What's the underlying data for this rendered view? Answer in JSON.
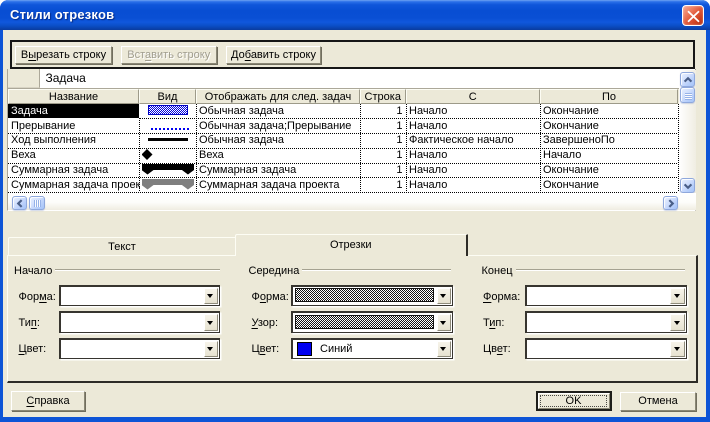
{
  "window": {
    "title": "Стили отрезков"
  },
  "toolbar": {
    "cut": {
      "pre": "В",
      "key": "ы",
      "post": "резать строку"
    },
    "insert": {
      "pre": "Вст",
      "key": "а",
      "post": "вить строку"
    },
    "add": {
      "pre": "До",
      "key": "б",
      "post": "авить строку"
    }
  },
  "entry_bar": {
    "value": "Задача"
  },
  "table": {
    "columns": [
      "Название",
      "Вид",
      "Отображать для след. задач",
      "Строка",
      "С",
      "По"
    ],
    "rows": [
      {
        "name": "Задача",
        "bar": "task-bar-blue-hatched",
        "show_for": "Обычная задача",
        "row": "1",
        "from": "Начало",
        "to": "Окончание",
        "selected": true
      },
      {
        "name": "Прерывание",
        "bar": "interruption-dotted-blue",
        "show_for": "Обычная задача;Прерывание",
        "row": "1",
        "from": "Начало",
        "to": "Окончание"
      },
      {
        "name": "Ход выполнения",
        "bar": "progress-solid-black",
        "show_for": "Обычная задача",
        "row": "1",
        "from": "Фактическое начало",
        "to": "ЗавершеноПо"
      },
      {
        "name": "Веха",
        "bar": "milestone-diamond",
        "show_for": "Веха",
        "row": "1",
        "from": "Начало",
        "to": "Начало"
      },
      {
        "name": "Суммарная задача",
        "bar": "summary-black",
        "show_for": "Суммарная задача",
        "row": "1",
        "from": "Начало",
        "to": "Окончание"
      },
      {
        "name": "Суммарная задача проекта",
        "bar": "project-summary-gray",
        "show_for": "Суммарная задача проекта",
        "row": "1",
        "from": "Начало",
        "to": "Окончание"
      }
    ]
  },
  "tabs": {
    "text": "Текст",
    "bars": "Отрезки"
  },
  "groups": {
    "start": {
      "label": "Начало",
      "shape": {
        "pre": "Фор",
        "key": "м",
        "post": "а:",
        "value": ""
      },
      "type": {
        "pre": "Ти",
        "key": "п",
        "post": ":",
        "value": ""
      },
      "color": {
        "pre": "",
        "key": "Ц",
        "post": "вет:",
        "value": ""
      }
    },
    "middle": {
      "label": "Середина",
      "shape": {
        "pre": "Ф",
        "key": "о",
        "post": "рма:",
        "value": "hatched-pattern-swatch"
      },
      "pattern": {
        "pre": "",
        "key": "У",
        "post": "зор:",
        "value": "hatched-pattern-swatch"
      },
      "color": {
        "pre": "Ц",
        "key": "в",
        "post": "ет:",
        "value": "Синий",
        "swatch": "#0000F0"
      }
    },
    "end": {
      "label": "Конец",
      "shape": {
        "pre": "",
        "key": "Ф",
        "post": "орма:",
        "value": ""
      },
      "type": {
        "pre": "Т",
        "key": "и",
        "post": "п:",
        "value": ""
      },
      "color": {
        "pre": "Цв",
        "key": "е",
        "post": "т:",
        "value": ""
      }
    }
  },
  "footer": {
    "help": {
      "pre": "",
      "key": "С",
      "post": "правка"
    },
    "ok": "OK",
    "cancel": "Отмена"
  },
  "colors": {
    "titlebar_blue": "#0A50D4",
    "dialog_face": "#ECE9D8",
    "selection_black": "#000000",
    "task_bar_blue": "#0000E8",
    "project_summary_gray": "#7F7F7F",
    "color_value_blue": "#0000F0",
    "scroll_arrow_slate": "#4A5F88",
    "close_button_red": "#D6502E"
  }
}
